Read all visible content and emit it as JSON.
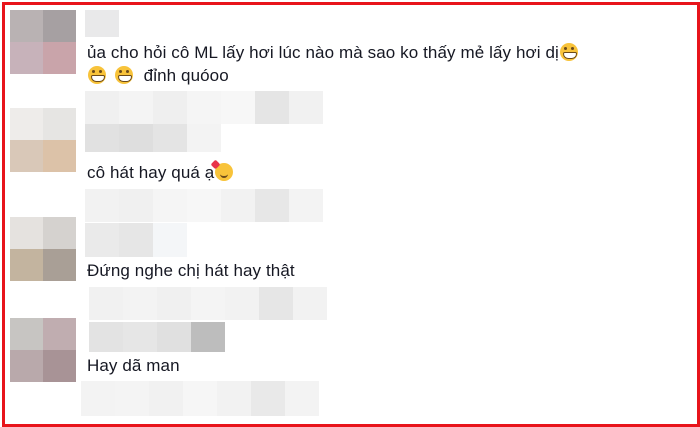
{
  "comments": [
    {
      "text_line1": "ủa cho hỏi cô ML lấy hơi lúc nào mà sao ko thấy mẻ lấy hơi dị",
      "text_line2": "đỉnh quóoo",
      "emojis": [
        "grin-face",
        "grin-face",
        "grin-face"
      ]
    },
    {
      "text_line1": "cô hát hay quá ạ",
      "emojis": [
        "smiling-face-with-hearts"
      ]
    },
    {
      "text_line1": "Đứng nghe chị hát hay thật",
      "emojis": []
    },
    {
      "text_line1": "Hay dã man",
      "emojis": []
    }
  ],
  "colors": {
    "frame_border": "#e8141b",
    "text": "#161823",
    "emoji": "#f8c33a"
  }
}
